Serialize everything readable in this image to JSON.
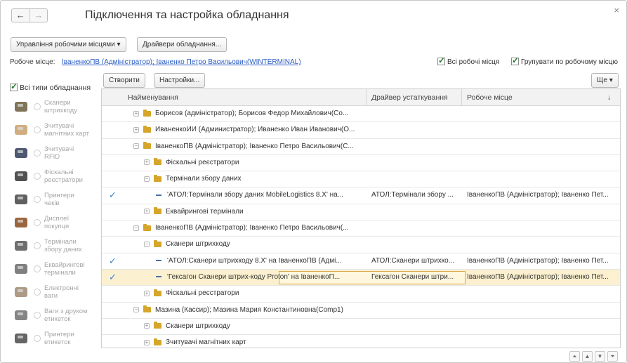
{
  "window": {
    "title": "Підключення та настройка обладнання",
    "close": "×",
    "back": "←",
    "forward": "→"
  },
  "toolbar": {
    "manage_label": "Управління робочими місцями ▾",
    "drivers_label": "Драйвери обладнання..."
  },
  "workstation": {
    "label": "Робоче місце:",
    "value": "ІваненкоПВ (Адміністратор); Іваненко Петро Васильович(WINTERMINAL)",
    "all_places": "Всі робочі місця",
    "group_by_place": "Групувати по робочому місцю"
  },
  "filter": {
    "all_types": "Всі типи обладнання"
  },
  "device_types": [
    {
      "icon": "barcode-scanner-icon",
      "label": "Сканери\nштрихкоду"
    },
    {
      "icon": "magstripe-reader-icon",
      "label": "Зчитувачі\nмагнітних карт"
    },
    {
      "icon": "rfid-reader-icon",
      "label": "Зчитувачі\nRFID"
    },
    {
      "icon": "fiscal-register-icon",
      "label": "Фіскальні\nреєстратори"
    },
    {
      "icon": "receipt-printer-icon",
      "label": "Принтери\nчеків"
    },
    {
      "icon": "customer-display-icon",
      "label": "Дисплеї\nпокупця"
    },
    {
      "icon": "data-terminal-icon",
      "label": "Термінали\nзбору даних"
    },
    {
      "icon": "acquiring-terminal-icon",
      "label": "Еквайрингові\nтермінали"
    },
    {
      "icon": "scales-icon",
      "label": "Електронні\nваги"
    },
    {
      "icon": "label-scales-icon",
      "label": "Ваги з друком\nетикеток"
    },
    {
      "icon": "label-printer-icon",
      "label": "Принтери\nетикеток"
    }
  ],
  "grid_toolbar": {
    "create_label": "Створити",
    "settings_label": "Настройки...",
    "more_label": "Ще ▾"
  },
  "columns": {
    "name": "Найменування",
    "driver": "Драйвер устаткування",
    "place": "Робоче місце",
    "sort": "↓"
  },
  "rows": [
    {
      "check": "",
      "pm": "+",
      "indent": 0,
      "kind": "folder",
      "name": "Борисов (адміністратор); Борисов Федор Михайлович(Co...",
      "driver": "",
      "place": "",
      "selected": false
    },
    {
      "check": "",
      "pm": "+",
      "indent": 0,
      "kind": "folder",
      "name": "ИваненкоИИ (Администратор); Иваненко Иван Иванович(О...",
      "driver": "",
      "place": "",
      "selected": false
    },
    {
      "check": "",
      "pm": "−",
      "indent": 0,
      "kind": "folder",
      "name": "ІваненкоПВ (Адміністратор); Іваненко Петро Васильович(С...",
      "driver": "",
      "place": "",
      "selected": false
    },
    {
      "check": "",
      "pm": "+",
      "indent": 1,
      "kind": "folder",
      "name": "Фіскальні реєстратори",
      "driver": "",
      "place": "",
      "selected": false
    },
    {
      "check": "",
      "pm": "−",
      "indent": 1,
      "kind": "folder",
      "name": "Термінали збору даних",
      "driver": "",
      "place": "",
      "selected": false
    },
    {
      "check": "✓",
      "pm": "",
      "indent": 2,
      "kind": "item",
      "name": "'АТОЛ:Термінали збору даних MobileLogistics 8.X' на...",
      "driver": "АТОЛ:Термінали збору ...",
      "place": "ІваненкоПВ (Адміністратор); Іваненко Пет...",
      "selected": false
    },
    {
      "check": "",
      "pm": "+",
      "indent": 1,
      "kind": "folder",
      "name": "Еквайрингові термінали",
      "driver": "",
      "place": "",
      "selected": false
    },
    {
      "check": "",
      "pm": "−",
      "indent": 0,
      "kind": "folder",
      "name": "ІваненкоПВ (Адміністратор); Іваненко Петро Васильович(...",
      "driver": "",
      "place": "",
      "selected": false
    },
    {
      "check": "",
      "pm": "−",
      "indent": 1,
      "kind": "folder",
      "name": "Сканери штрихкоду",
      "driver": "",
      "place": "",
      "selected": false
    },
    {
      "check": "✓",
      "pm": "",
      "indent": 2,
      "kind": "item",
      "name": "'АТОЛ:Сканери штрихкоду 8.X' на ІваненкоПВ (Адмі...",
      "driver": "АТОЛ:Сканери штрихко...",
      "place": "ІваненкоПВ (Адміністратор); Іваненко Пет...",
      "selected": false
    },
    {
      "check": "✓",
      "pm": "",
      "indent": 2,
      "kind": "item",
      "name": "'Гексагон Сканери штрих-коду Proton' на ІваненкоП...",
      "driver": "Гексагон Сканери штри...",
      "place": "ІваненкоПВ (Адміністратор); Іваненко Пет...",
      "selected": true
    },
    {
      "check": "",
      "pm": "+",
      "indent": 1,
      "kind": "folder",
      "name": "Фіскальні реєстратори",
      "driver": "",
      "place": "",
      "selected": false
    },
    {
      "check": "",
      "pm": "−",
      "indent": 0,
      "kind": "folder",
      "name": "Мазина (Кассир); Мазина Мария Константиновна(Comp1)",
      "driver": "",
      "place": "",
      "selected": false
    },
    {
      "check": "",
      "pm": "+",
      "indent": 1,
      "kind": "folder",
      "name": "Сканери штрихкоду",
      "driver": "",
      "place": "",
      "selected": false
    },
    {
      "check": "",
      "pm": "+",
      "indent": 1,
      "kind": "folder",
      "name": "Зчитувачі магнітних карт",
      "driver": "",
      "place": "",
      "selected": false
    }
  ],
  "pager": [
    "⏶",
    "▲",
    "▼",
    "⏷"
  ],
  "colors": {
    "link": "#2a5cc2",
    "check": "#3b82d1",
    "folder": "#d6a62a",
    "selected_row": "#fbf0cf"
  }
}
